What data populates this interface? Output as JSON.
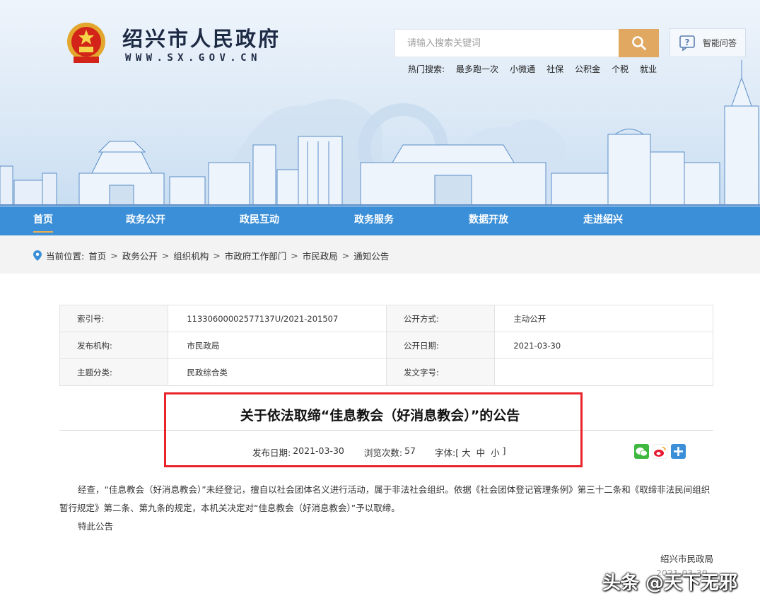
{
  "header": {
    "site_title": "绍兴市人民政府",
    "site_url": "WWW.SX.GOV.CN",
    "search_placeholder": "请输入搜索关键词",
    "qa_label": "智能问答",
    "hot_label": "热门搜索:",
    "hot_items": [
      "最多跑一次",
      "小微通",
      "社保",
      "公积金",
      "个税",
      "就业"
    ]
  },
  "nav": [
    "首页",
    "政务公开",
    "政民互动",
    "政务服务",
    "数据开放",
    "走进绍兴"
  ],
  "breadcrumb": {
    "label": "当前位置:",
    "items": [
      "首页",
      "政务公开",
      "组织机构",
      "市政府工作部门",
      "市民政局",
      "通知公告"
    ],
    "sep": ">"
  },
  "info": {
    "index_key": "索引号:",
    "index_val": "11330600002577137U/2021-201507",
    "open_key": "公开方式:",
    "open_val": "主动公开",
    "org_key": "发布机构:",
    "org_val": "市民政局",
    "date_key": "公开日期:",
    "date_val": "2021-03-30",
    "topic_key": "主题分类:",
    "topic_val": "民政综合类",
    "docno_key": "发文字号:",
    "docno_val": ""
  },
  "article": {
    "title": "关于依法取缔“佳息教会（好消息教会）”的公告",
    "date_label": "发布日期:",
    "date": "2021-03-30",
    "views_label": "浏览次数:",
    "views": "57",
    "font_label": "字体:[",
    "font_big": "大",
    "font_mid": "中",
    "font_small": "小",
    "font_end": "]",
    "para1": "经查，“佳息教会（好消息教会）”未经登记，擅自以社会团体名义进行活动，属于非法社会组织。依据《社会团体登记管理条例》第三十二条和《取缔非法民间组织暂行规定》第二条、第九条的规定，本机关决定对“佳息教会（好消息教会）”予以取缔。",
    "para2": "特此公告",
    "signature": "绍兴市民政局",
    "signature_date": "2021-03-30"
  },
  "watermark": "头条 @天下无邪",
  "colors": {
    "nav_bg": "#3b8fd8",
    "search_btn": "#e0a860",
    "highlight_border": "#e8242a"
  }
}
